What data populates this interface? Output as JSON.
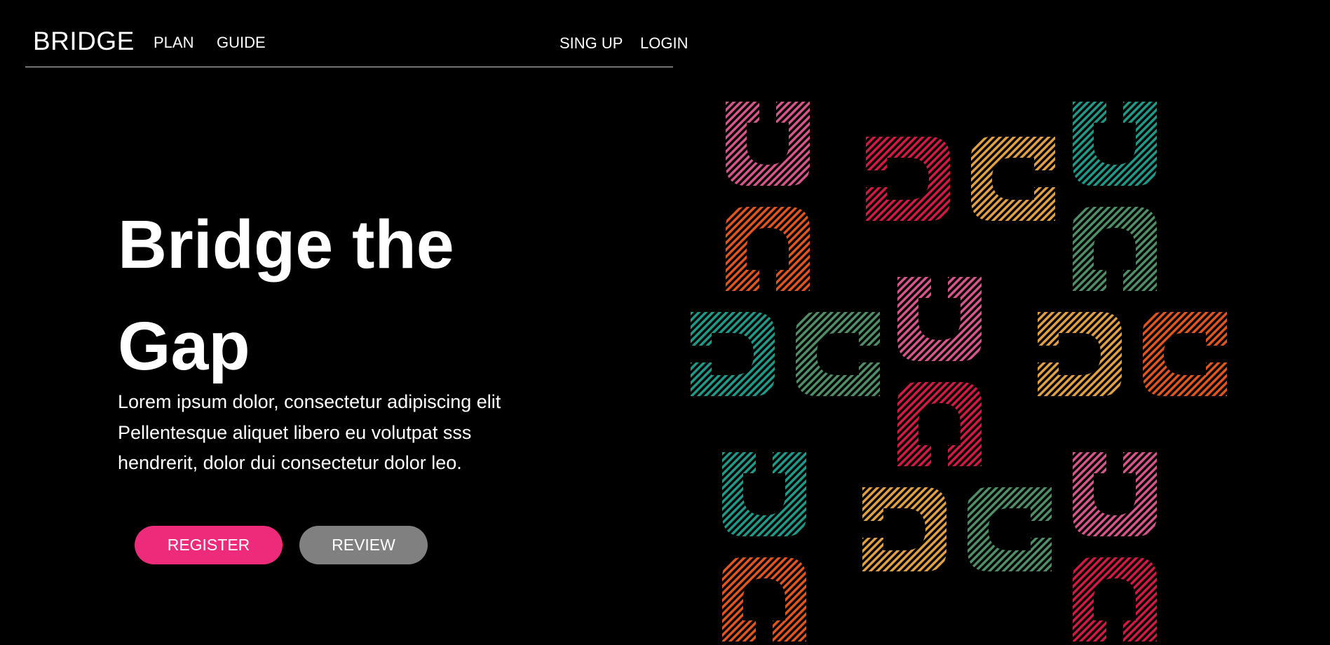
{
  "header": {
    "brand": "BRIDGE",
    "nav_left": [
      "PLAN",
      "GUIDE"
    ],
    "nav_right": [
      "SING UP",
      "LOGIN"
    ]
  },
  "hero": {
    "title": "Bridge the Gap",
    "text": "Lorem ipsum dolor, consectetur adipiscing elit Pellentesque aliquet libero eu volutpat sss hendrerit, dolor dui consectetur dolor leo.",
    "register_label": "REGISTER",
    "review_label": "REVIEW"
  },
  "colors": {
    "background": "#000000",
    "register": "#ee2a7b",
    "review": "#808080",
    "pink": "#d6558a",
    "crimson": "#d21a44",
    "orange": "#e0561e",
    "gold": "#e0a043",
    "teal": "#1f9a89",
    "sage": "#4f8e67"
  },
  "pattern": {
    "tiles": [
      {
        "o": "up",
        "c": "pink"
      },
      {
        "o": "right",
        "c": "crimson"
      },
      {
        "o": "left",
        "c": "gold"
      },
      {
        "o": "up",
        "c": "teal"
      },
      {
        "o": "down",
        "c": "orange"
      },
      {
        "o": "down",
        "c": "sage"
      },
      {
        "o": "right",
        "c": "teal"
      },
      {
        "o": "left",
        "c": "sage"
      },
      {
        "o": "up",
        "c": "pink"
      },
      {
        "o": "right",
        "c": "gold"
      },
      {
        "o": "left",
        "c": "orange"
      },
      {
        "o": "down",
        "c": "crimson"
      },
      {
        "o": "up",
        "c": "teal"
      },
      {
        "o": "right",
        "c": "gold"
      },
      {
        "o": "left",
        "c": "sage"
      },
      {
        "o": "up",
        "c": "pink"
      },
      {
        "o": "down",
        "c": "orange"
      },
      {
        "o": "down",
        "c": "crimson"
      }
    ]
  }
}
